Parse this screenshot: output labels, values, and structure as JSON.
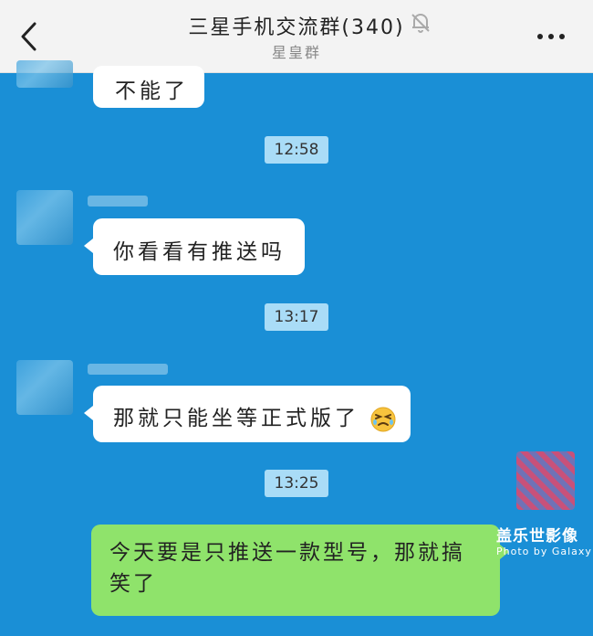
{
  "header": {
    "title": "三星手机交流群(340)",
    "subtitle": "星皇群",
    "back_icon": "chevron-left-icon",
    "mute_icon": "bell-off-icon",
    "more_icon": "more-horizontal-icon"
  },
  "messages": [
    {
      "type": "incoming",
      "text": "不能了"
    },
    {
      "type": "time",
      "text": "12:58"
    },
    {
      "type": "incoming",
      "text": "你看看有推送吗"
    },
    {
      "type": "time",
      "text": "13:17"
    },
    {
      "type": "incoming",
      "text": "那就只能坐等正式版了",
      "emoji": "squinting-face-emoji"
    },
    {
      "type": "time",
      "text": "13:25"
    },
    {
      "type": "outgoing",
      "text_line1": "今天要是只推送一款型号，那就搞",
      "text_line2": "笑了"
    }
  ],
  "watermark": {
    "line1": "盖乐世影像",
    "line2": "Photo by Galaxy"
  },
  "colors": {
    "chat_background": "#1a8fd6",
    "incoming_bubble": "#ffffff",
    "outgoing_bubble": "#8fe36b",
    "timestamp_background": "#a9dcf7"
  }
}
